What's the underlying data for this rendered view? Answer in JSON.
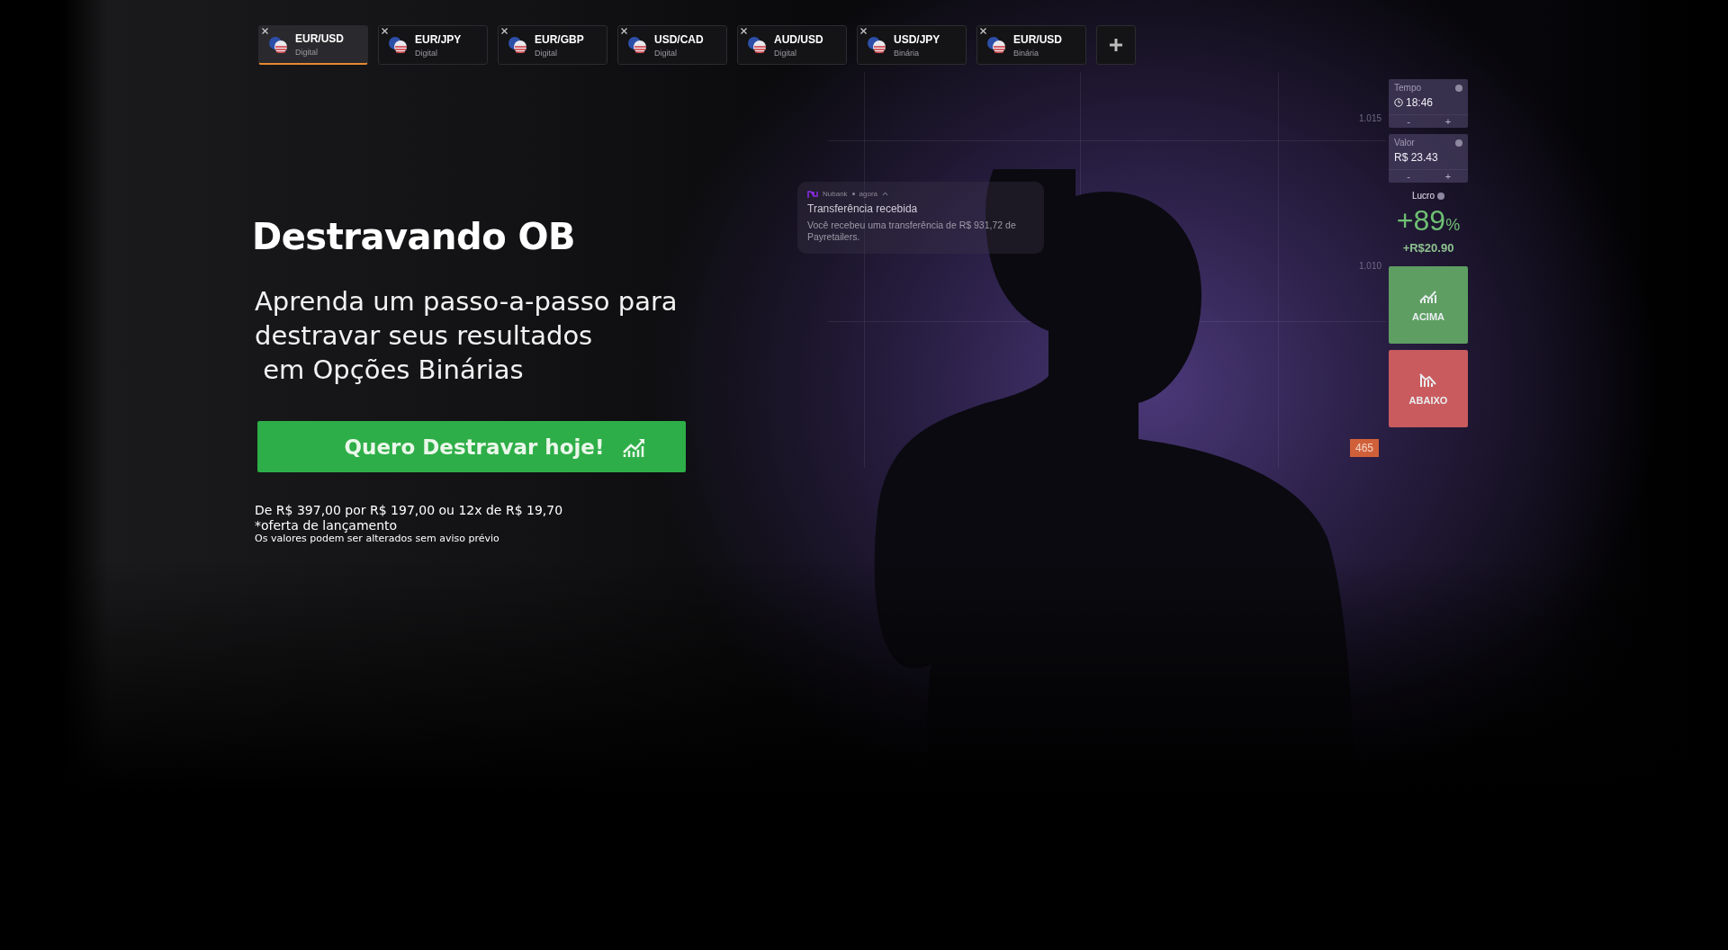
{
  "asset_tabs": [
    {
      "pair": "EUR/USD",
      "type": "Digital",
      "selected": true
    },
    {
      "pair": "EUR/JPY",
      "type": "Digital",
      "selected": false
    },
    {
      "pair": "EUR/GBP",
      "type": "Digital",
      "selected": false
    },
    {
      "pair": "USD/CAD",
      "type": "Digital",
      "selected": false
    },
    {
      "pair": "AUD/USD",
      "type": "Digital",
      "selected": false
    },
    {
      "pair": "USD/JPY",
      "type": "Binária",
      "selected": false
    },
    {
      "pair": "EUR/USD",
      "type": "Binária",
      "selected": false
    }
  ],
  "hero": {
    "title": "Destravando OB",
    "subtitle": "Aprenda um passo-a-passo para\ndestravar seus resultados\n em Opções Binárias",
    "cta": "Quero Destravar hoje!",
    "price": "De R$ 397,00 por R$ 197,00 ou 12x de R$ 19,70",
    "offer_note": "*oferta de lançamento",
    "disclaimer": "Os valores podem ser alterados sem aviso prévio"
  },
  "notification": {
    "app": "Nubank",
    "time": "agora",
    "title": "Transferência recebida",
    "body": "Você recebeu uma transferência de R$ 931,72 de Payretailers."
  },
  "chart": {
    "price_labels": [
      "1.015",
      "1.010"
    ],
    "price_tag": "465"
  },
  "trade_panel": {
    "fields": [
      {
        "label": "Tempo",
        "value": "18:46",
        "kind": "time",
        "decrease": "-",
        "increase": "+"
      },
      {
        "label": "Valor",
        "value": "R$ 23.43",
        "kind": "amount",
        "decrease": "-",
        "increase": "+"
      }
    ],
    "profit": {
      "label": "Lucro",
      "percent": "+89",
      "percent_sign": "%",
      "amount": "+R$20.90"
    },
    "buttons": [
      {
        "kind": "up",
        "label": "ACIMA"
      },
      {
        "kind": "down",
        "label": "ABAIXO"
      }
    ]
  }
}
